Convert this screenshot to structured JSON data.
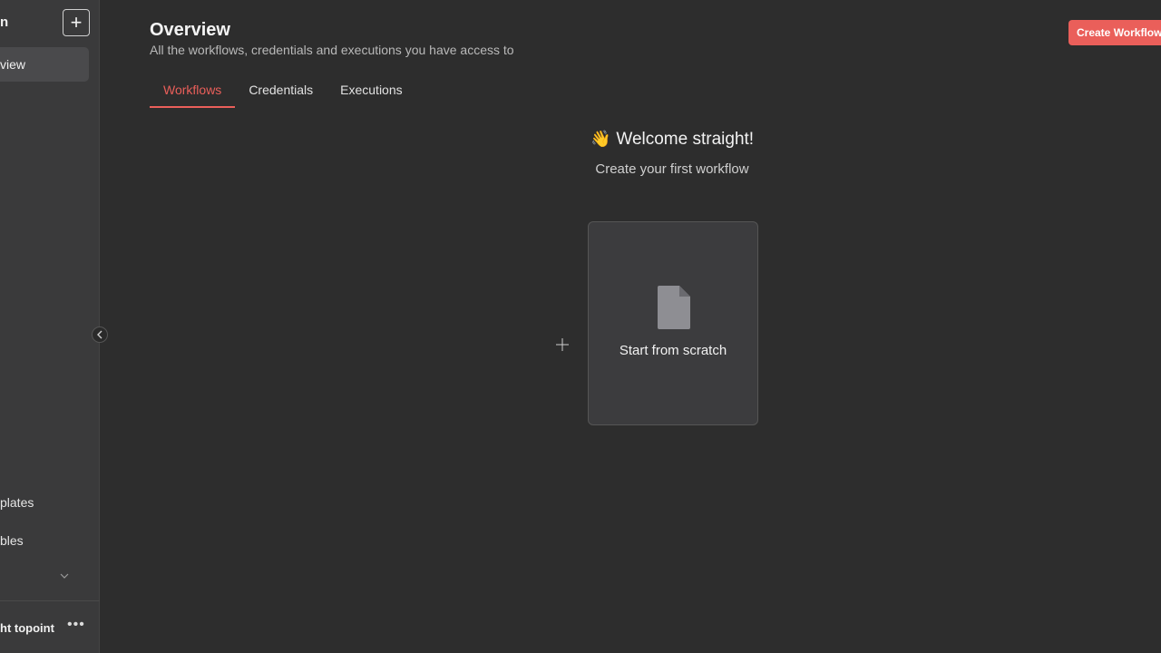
{
  "sidebar": {
    "logo_text": "n",
    "add_label": "+",
    "items": [
      {
        "label": "view"
      },
      {
        "label": "plates"
      },
      {
        "label": "bles"
      }
    ],
    "user_name": "ht topoint",
    "more_label": "•••"
  },
  "header": {
    "title": "Overview",
    "subtitle": "All the workflows, credentials and executions you have access to",
    "create_button": "Create Workflow"
  },
  "tabs": [
    {
      "label": "Workflows",
      "active": true
    },
    {
      "label": "Credentials",
      "active": false
    },
    {
      "label": "Executions",
      "active": false
    }
  ],
  "welcome": {
    "emoji": "👋",
    "title": "Welcome straight!",
    "subtitle": "Create your first workflow"
  },
  "card": {
    "label": "Start from scratch",
    "icon": "file-icon"
  },
  "colors": {
    "accent": "#ea5f5a",
    "background": "#2d2d2d",
    "sidebar": "#3a3a3b"
  }
}
